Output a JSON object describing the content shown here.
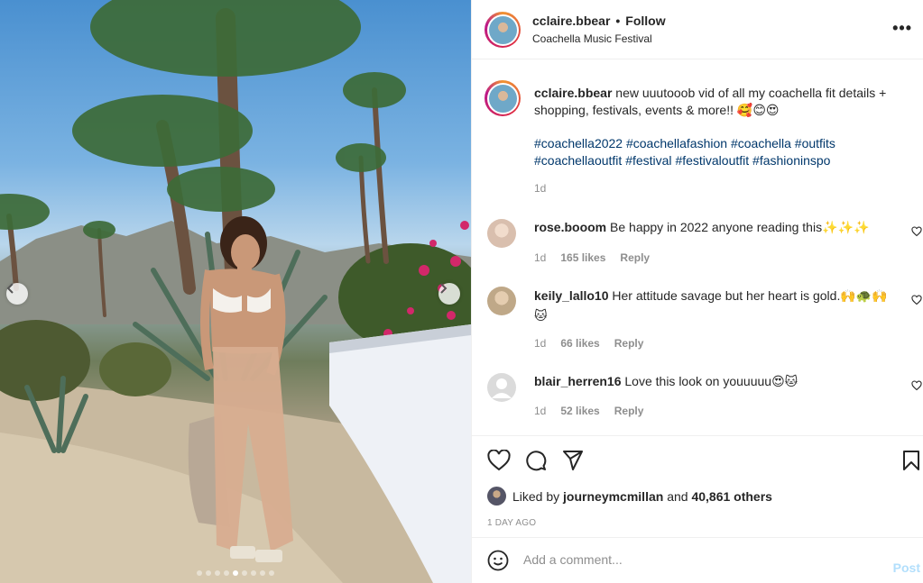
{
  "post": {
    "username": "cclaire.bbear",
    "follow_label": "Follow",
    "separator": "•",
    "location": "Coachella Music Festival",
    "more_icon": "more-horizontal-icon",
    "more_label": "•••"
  },
  "caption": {
    "username": "cclaire.bbear",
    "text": "new uuutooob vid of all my coachella fit details + shopping, festivals, events & more!! 🥰😊😍",
    "hashtags": [
      "#coachella2022",
      "#coachellafashion",
      "#coachella",
      "#outfits",
      "#coachellaoutfit",
      "#festival",
      "#festivaloutfit",
      "#fashioninspo"
    ],
    "time": "1d"
  },
  "comments": [
    {
      "username": "rose.booom",
      "text": "Be happy in 2022 anyone reading this✨✨✨",
      "time": "1d",
      "likes": "165 likes",
      "reply": "Reply",
      "avatar_color": "#e8d0c0"
    },
    {
      "username": "keily_lallo10",
      "text": "Her attitude savage but her heart is gold.🙌🐢🙌🐱",
      "time": "1d",
      "likes": "66 likes",
      "reply": "Reply",
      "avatar_color": "#d8c4a8"
    },
    {
      "username": "blair_herren16",
      "text": "Love this look on youuuuu😍🐱",
      "time": "1d",
      "likes": "52 likes",
      "reply": "Reply",
      "avatar_color": "#dbdbdb"
    }
  ],
  "actions": {
    "like_icon": "heart-icon",
    "comment_icon": "comment-icon",
    "share_icon": "send-icon",
    "save_icon": "bookmark-icon"
  },
  "likes": {
    "prefix": "Liked by",
    "user": "journeymcmillan",
    "and": "and",
    "others": "40,861 others"
  },
  "time_ago": "1 DAY AGO",
  "add_comment": {
    "placeholder": "Add a comment...",
    "post_label": "Post",
    "emoji_icon": "smiley-icon"
  },
  "carousel": {
    "total": 9,
    "active": 4
  },
  "colors": {
    "link": "#00376b",
    "muted": "#8e8e8e",
    "post_disabled": "#b2dffc"
  }
}
